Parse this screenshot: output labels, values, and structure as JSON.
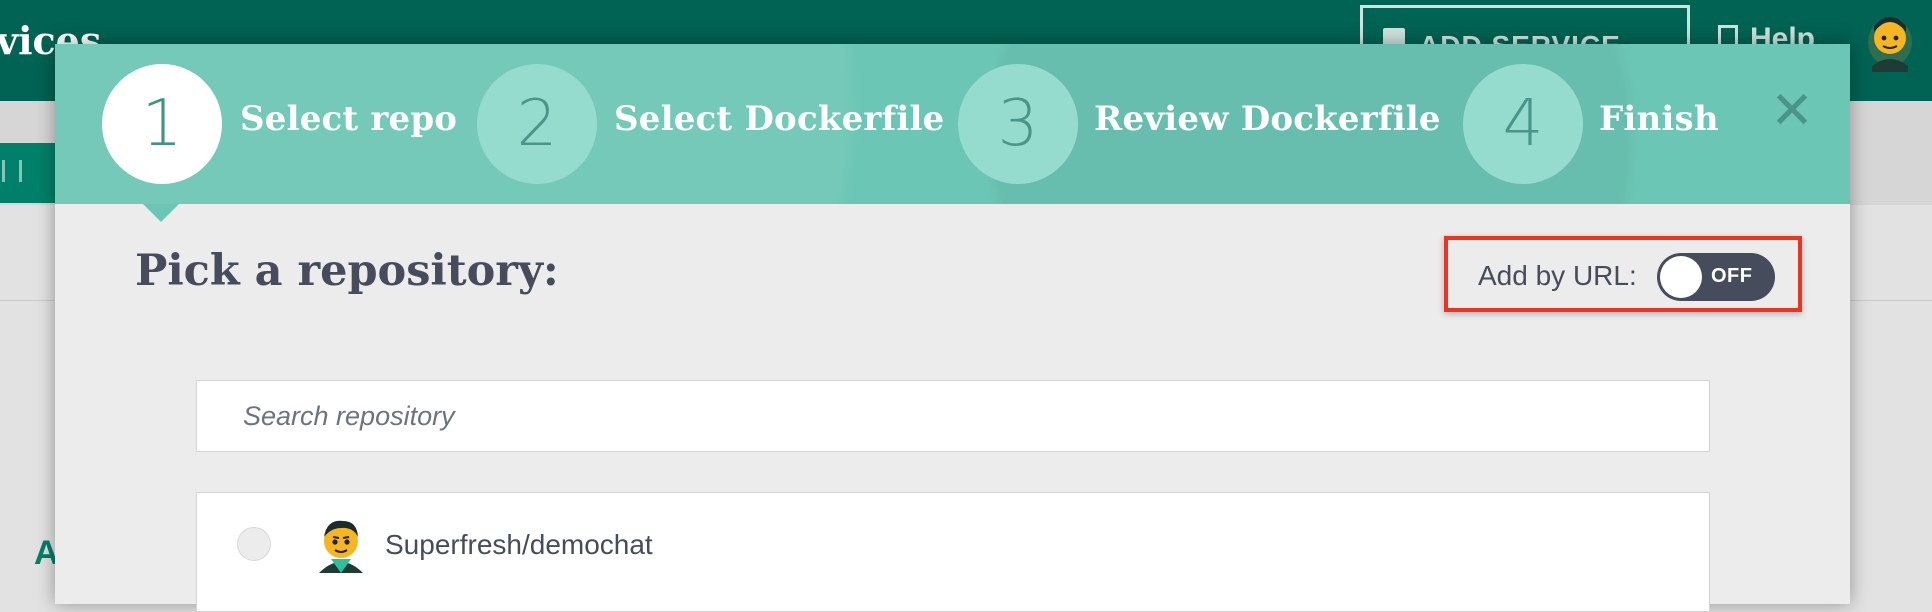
{
  "background": {
    "title": "vices",
    "add_service_label": "ADD SERVICE",
    "help_label": "Help",
    "partial_letter": "A"
  },
  "modal": {
    "steps": [
      {
        "number": "1",
        "label": "Select repo",
        "active": true
      },
      {
        "number": "2",
        "label": "Select Dockerfile",
        "active": false
      },
      {
        "number": "3",
        "label": "Review Dockerfile",
        "active": false
      },
      {
        "number": "4",
        "label": "Finish",
        "active": false
      }
    ],
    "close_label": "✕",
    "section_title": "Pick a repository:",
    "add_by_url": {
      "label": "Add by URL:",
      "state": "OFF"
    },
    "search": {
      "placeholder": "Search repository",
      "value": ""
    },
    "repos": [
      {
        "name": "Superfresh/demochat",
        "selected": false
      }
    ]
  },
  "colors": {
    "header_bg": "#006353",
    "stepper_bg": "#6cc6b5",
    "step_circle": "#95dccf",
    "highlight_box": "#ec3423",
    "toggle_bg": "#464c5c"
  },
  "icons": {
    "close": "close-icon",
    "add_service": "server-icon",
    "help": "document-icon"
  }
}
